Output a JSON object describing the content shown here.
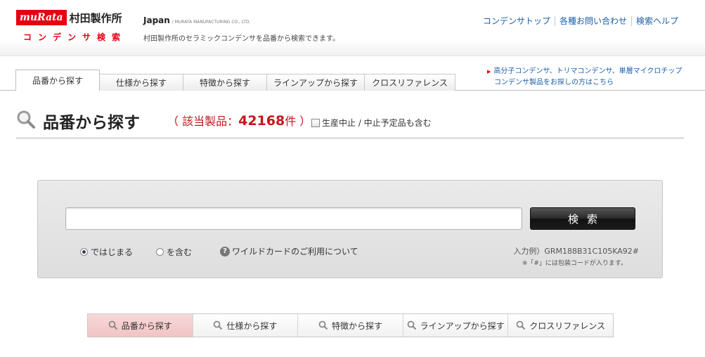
{
  "header": {
    "logo_en": "muRata",
    "logo_jp": "村田製作所",
    "logo_sub": "コンデンサ検索",
    "region": "Japan",
    "company_en": "/ MURATA MANUFACTURING CO., LTD.",
    "tagline": "村田製作所のセラミックコンデンサを品番から検索できます。",
    "links": [
      "コンデンサトップ",
      "各種お問い合わせ",
      "検索ヘルプ"
    ]
  },
  "tabs": [
    {
      "label": "品番から探す",
      "active": true
    },
    {
      "label": "仕様から探す",
      "active": false
    },
    {
      "label": "特徴から探す",
      "active": false
    },
    {
      "label": "ラインアップから探す",
      "active": false
    },
    {
      "label": "クロスリファレンス",
      "active": false
    }
  ],
  "side_note": {
    "line1": "高分子コンデンサ、トリマコンデンサ、単層マイクロチップ",
    "line2": "コンデンサ製品をお探しの方はこちら"
  },
  "title": {
    "text": "品番から探す",
    "count_prefix": "（ 該当製品：",
    "count_value": "42168",
    "count_suffix": "件 ）",
    "discontinued_label": "生産中止 / 中止予定品も含む",
    "discontinued_checked": false
  },
  "search": {
    "input_value": "",
    "button_label": "検索",
    "options": [
      {
        "label": "ではじまる",
        "selected": true
      },
      {
        "label": "を含む",
        "selected": false
      }
    ],
    "help_label": "ワイルドカードのご利用について",
    "example": "入力例）GRM188B31C105KA92#",
    "example_note": "※「#」には包装コードが入ります。"
  },
  "bottom_nav": [
    {
      "label": "品番から探す",
      "active": true
    },
    {
      "label": "仕様から探す",
      "active": false
    },
    {
      "label": "特徴から探す",
      "active": false
    },
    {
      "label": "ラインアップから探す",
      "active": false
    },
    {
      "label": "クロスリファレンス",
      "active": false
    }
  ],
  "colors": {
    "brand_red": "#e60012",
    "link_blue": "#1a5ea8",
    "count_red": "#c4161c"
  }
}
